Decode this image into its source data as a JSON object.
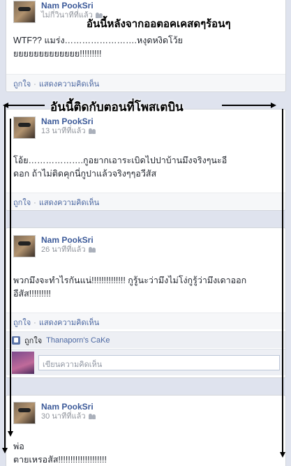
{
  "posts": [
    {
      "author": "Nam PookSri",
      "time": "ไม่กี่วินาทีที่แล้ว",
      "text": "WTF?? แมร่ง…………………….หงุดหงิดโว้ย\nยยยยยยยยยยยยย!!!!!!!!!",
      "like": "ถูกใจ",
      "comment": "แสดงความคิดเห็น"
    },
    {
      "author": "Nam PookSri",
      "time": "13 นาทีที่แล้ว",
      "text": "โอ้ย……………….กูอยากเอาระเบิดไปปาบ้านมึงจริงๆนะอี\nดอก ถ้าไม่ติดคุกนี่กูปาแล้วจริงๆๆอวีสัส",
      "like": "ถูกใจ",
      "comment": "แสดงความคิดเห็น"
    },
    {
      "author": "Nam PookSri",
      "time": "26 นาทีที่แล้ว",
      "text": "พวกมึงจะทำไรกันแน่!!!!!!!!!!!!!! กูรู้นะว่ามึงไม่โง่กูรู้ว่ามึงเดาออก\nอีสัส!!!!!!!!!",
      "like": "ถูกใจ",
      "comment": "แสดงความคิดเห็น",
      "liked_by_prefix": "ถูกใจ",
      "liked_by": "Thanaporn's CaKe",
      "comment_placeholder": "เขียนความคิดเห็น"
    },
    {
      "author": "Nam PookSri",
      "time": "30 นาทีที่แล้ว",
      "text": "พ่อ\nตายเหรอสัส!!!!!!!!!!!!!!!!!!!!"
    }
  ],
  "annotations": {
    "top": "อันนี้หลังจากออตอคเคสดๆร้อนๆ",
    "middle": "อันนี้ติดกับตอนที่โพสเตบิน"
  },
  "colors": {
    "link": "#3b5998",
    "background": "#dfe3ee"
  }
}
